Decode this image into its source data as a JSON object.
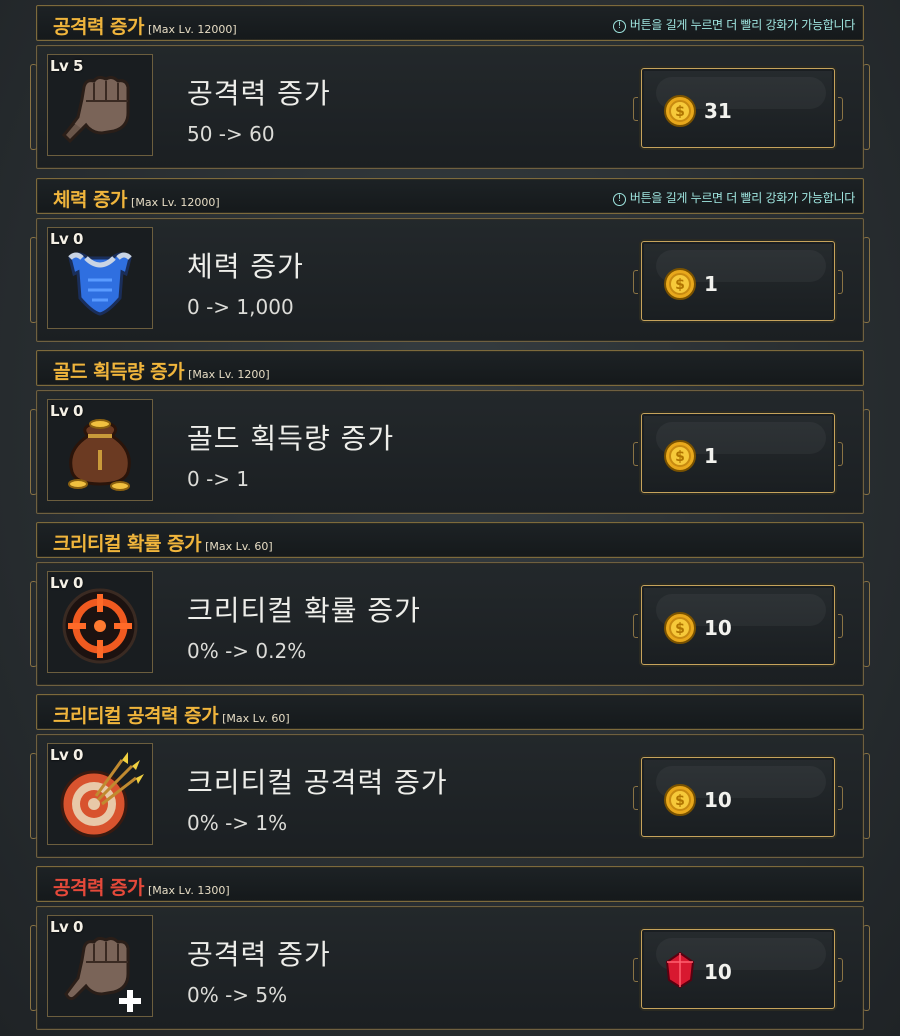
{
  "notice_text": "버튼을 길게 누르면 더 빨리 강화가 가능합니다",
  "upgrades": [
    {
      "header_title": "공격력 증가",
      "max_level": "[Max Lv. 12000]",
      "level": "Lv 5",
      "name": "공격력 증가",
      "value": "50 -> 60",
      "cost": "31",
      "currency": "gold-coin",
      "icon": "fist-icon",
      "title_color": "#f0b53c"
    },
    {
      "header_title": "체력 증가",
      "max_level": "[Max Lv. 12000]",
      "level": "Lv 0",
      "name": "체력 증가",
      "value": "0 -> 1,000",
      "cost": "1",
      "currency": "gold-coin",
      "icon": "armor-icon",
      "title_color": "#f0b53c"
    },
    {
      "header_title": "골드 획득량 증가",
      "max_level": "[Max Lv. 1200]",
      "level": "Lv 0",
      "name": "골드 획득량 증가",
      "value": "0 -> 1",
      "cost": "1",
      "currency": "gold-coin",
      "icon": "gold-bag-icon",
      "title_color": "#f0b53c"
    },
    {
      "header_title": "크리티컬 확률 증가",
      "max_level": "[Max Lv. 60]",
      "level": "Lv 0",
      "name": "크리티컬 확률 증가",
      "value": "0% -> 0.2%",
      "cost": "10",
      "currency": "gold-coin",
      "icon": "crosshair-icon",
      "title_color": "#f0b53c"
    },
    {
      "header_title": "크리티컬 공격력 증가",
      "max_level": "[Max Lv. 60]",
      "level": "Lv 0",
      "name": "크리티컬 공격력 증가",
      "value": "0% -> 1%",
      "cost": "10",
      "currency": "gold-coin",
      "icon": "target-arrows-icon",
      "title_color": "#f0b53c"
    },
    {
      "header_title": "공격력 증가",
      "max_level": "[Max Lv. 1300]",
      "level": "Lv 0",
      "name": "공격력 증가",
      "value": "0% -> 5%",
      "cost": "10",
      "currency": "red-gem",
      "icon": "fist-plus-icon",
      "title_color": "#e5493a"
    }
  ]
}
